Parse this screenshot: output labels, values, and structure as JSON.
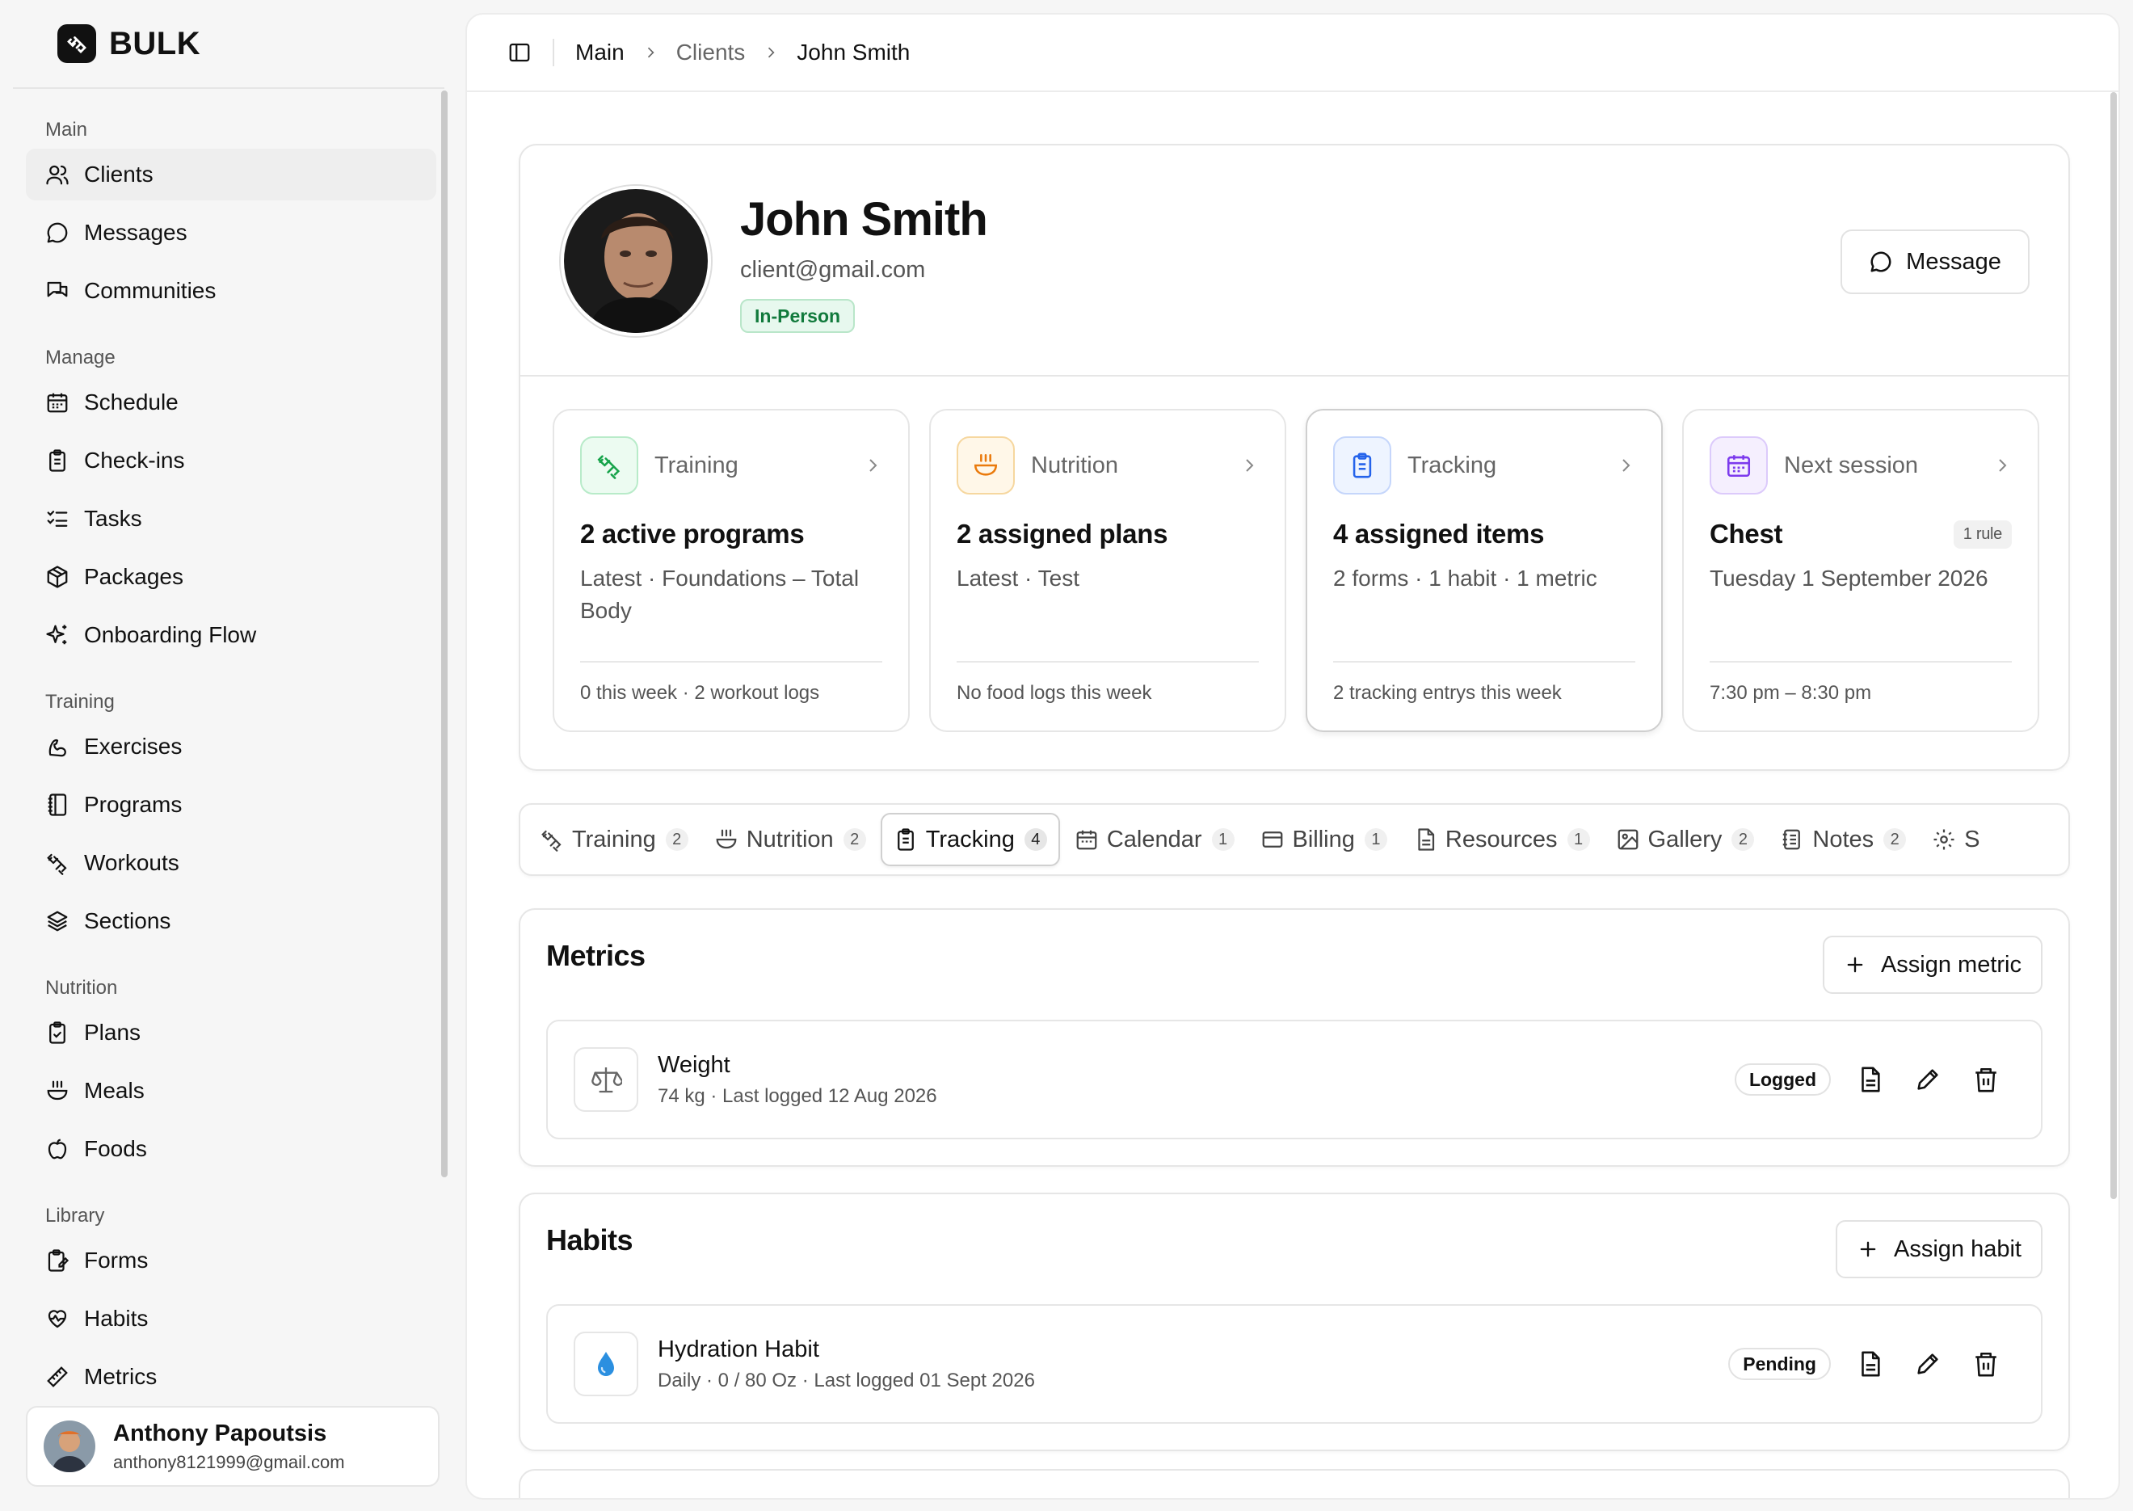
{
  "app": {
    "name": "BULK"
  },
  "sidebar": {
    "sections": [
      {
        "label": "Main"
      },
      {
        "label": "Manage"
      },
      {
        "label": "Training"
      },
      {
        "label": "Nutrition"
      },
      {
        "label": "Library"
      }
    ],
    "items": [
      {
        "label": "Clients",
        "icon": "users-icon"
      },
      {
        "label": "Messages",
        "icon": "chat-icon"
      },
      {
        "label": "Communities",
        "icon": "chats-icon"
      },
      {
        "label": "Schedule",
        "icon": "calendar-icon"
      },
      {
        "label": "Check-ins",
        "icon": "clipboard-icon"
      },
      {
        "label": "Tasks",
        "icon": "list-checks-icon"
      },
      {
        "label": "Packages",
        "icon": "package-icon"
      },
      {
        "label": "Onboarding Flow",
        "icon": "sparkles-icon"
      },
      {
        "label": "Exercises",
        "icon": "muscle-icon"
      },
      {
        "label": "Programs",
        "icon": "book-icon"
      },
      {
        "label": "Workouts",
        "icon": "dumbbell-icon"
      },
      {
        "label": "Sections",
        "icon": "layers-icon"
      },
      {
        "label": "Plans",
        "icon": "clipboard-check-icon"
      },
      {
        "label": "Meals",
        "icon": "bowl-icon"
      },
      {
        "label": "Foods",
        "icon": "apple-icon"
      },
      {
        "label": "Forms",
        "icon": "form-icon"
      },
      {
        "label": "Habits",
        "icon": "heart-pulse-icon"
      },
      {
        "label": "Metrics",
        "icon": "ruler-icon"
      }
    ],
    "user": {
      "name": "Anthony Papoutsis",
      "email": "anthony8121999@gmail.com"
    }
  },
  "breadcrumb": [
    "Main",
    "Clients",
    "John Smith"
  ],
  "client": {
    "name": "John Smith",
    "email": "client@gmail.com",
    "badge": "In-Person",
    "message_label": "Message"
  },
  "cards": [
    {
      "label": "Training",
      "title": "2 active programs",
      "sub": "Latest · Foundations – Total Body",
      "foot": "0 this week · 2 workout logs",
      "accent": "#16a34a"
    },
    {
      "label": "Nutrition",
      "title": "2 assigned plans",
      "sub": "Latest · Test",
      "foot": "No food logs this week",
      "accent": "#ea7a0c"
    },
    {
      "label": "Tracking",
      "title": "4 assigned items",
      "sub": "2 forms · 1 habit · 1 metric",
      "foot": "2 tracking entrys this week",
      "accent": "#2563eb"
    },
    {
      "label": "Next session",
      "title": "Chest",
      "pill": "1 rule",
      "sub": "Tuesday 1 September 2026",
      "foot": "7:30 pm – 8:30 pm",
      "accent": "#7c3aed"
    }
  ],
  "tabs": [
    {
      "label": "Training",
      "count": "2"
    },
    {
      "label": "Nutrition",
      "count": "2"
    },
    {
      "label": "Tracking",
      "count": "4"
    },
    {
      "label": "Calendar",
      "count": "1"
    },
    {
      "label": "Billing",
      "count": "1"
    },
    {
      "label": "Resources",
      "count": "1"
    },
    {
      "label": "Gallery",
      "count": "2"
    },
    {
      "label": "Notes",
      "count": "2"
    },
    {
      "label": "S"
    }
  ],
  "metrics": {
    "title": "Metrics",
    "assign_label": "Assign metric",
    "items": [
      {
        "title": "Weight",
        "sub": "74 kg · Last logged 12 Aug 2026",
        "status": "Logged"
      }
    ]
  },
  "habits": {
    "title": "Habits",
    "assign_label": "Assign habit",
    "items": [
      {
        "title": "Hydration Habit",
        "sub": "Daily · 0 / 80 Oz · Last logged 01 Sept 2026",
        "status": "Pending"
      }
    ]
  }
}
